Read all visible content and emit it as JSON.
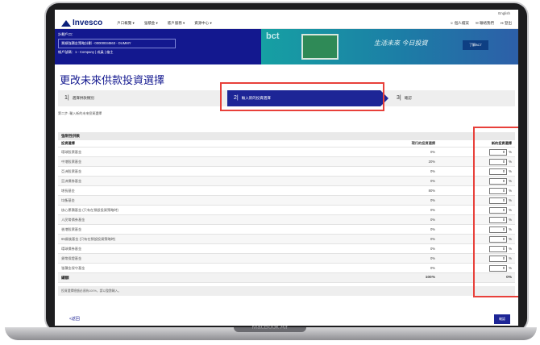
{
  "device": {
    "brand": "MacBook Air"
  },
  "topbar": {
    "language": "English"
  },
  "nav": {
    "logo": "Invesco",
    "menu": [
      "戶口概覽 ▾",
      "強積金 ▾",
      "賬戶服務 ▾",
      "資源中心 ▾"
    ],
    "right": [
      "個人檔案",
      "聯絡我們",
      "登出"
    ]
  },
  "account": {
    "label": "計劃戶口：",
    "plan": "景順強積金策略計劃 - 00000034563 - DUMMY",
    "member_label": "帳戶號碼：1 - Company | 成員 | 僱主",
    "member_box": ""
  },
  "promo": {
    "logo": "bct",
    "script": "生活未來 今日投資",
    "cta": "了解BCT"
  },
  "page": {
    "title": "更改未來供款投資選擇",
    "breadcrumb": "第二步: 輸入新的未來投資選擇"
  },
  "steps": [
    {
      "num": "1|",
      "label": "選擇供款類別"
    },
    {
      "num": "2|",
      "label": "輸入新的投資選擇"
    },
    {
      "num": "3|",
      "label": "確認"
    }
  ],
  "table": {
    "section": "強制性供款",
    "headers": {
      "fund": "投資選擇",
      "current": "現行的投資選擇",
      "new": "新的投資選擇"
    },
    "rows": [
      {
        "fund": "環球股票基金",
        "current": "0%",
        "new": "0"
      },
      {
        "fund": "中港股票基金",
        "current": "20%",
        "new": "0"
      },
      {
        "fund": "亞洲股票基金",
        "current": "0%",
        "new": "0"
      },
      {
        "fund": "亞洲債券基金",
        "current": "0%",
        "new": "0"
      },
      {
        "fund": "增長基金",
        "current": "80%",
        "new": "0"
      },
      {
        "fund": "均衡基金",
        "current": "0%",
        "new": "0"
      },
      {
        "fund": "核心累積基金 (只有在預設投資策略時)",
        "current": "0%",
        "new": "0"
      },
      {
        "fund": "人民幣債券基金",
        "current": "0%",
        "new": "0"
      },
      {
        "fund": "香港股票基金",
        "current": "0%",
        "new": "0"
      },
      {
        "fund": "65歲後基金 (只有在預設投資策略時)",
        "current": "0%",
        "new": "0"
      },
      {
        "fund": "環球債券基金",
        "current": "0%",
        "new": "0"
      },
      {
        "fund": "貨幣保證基金",
        "current": "0%",
        "new": "0"
      },
      {
        "fund": "強積金保守基金",
        "current": "0%",
        "new": "0"
      }
    ],
    "unit": "%",
    "total": {
      "label": "總額",
      "current": "100%",
      "new": "0%"
    },
    "note": "投資選擇總額必須為100%，請以整數輸入。"
  },
  "footer": {
    "back": "<返回",
    "confirm": "確認"
  },
  "colors": {
    "brand": "#13188f",
    "highlight": "#e8403a",
    "promo": "#16a0a3"
  }
}
